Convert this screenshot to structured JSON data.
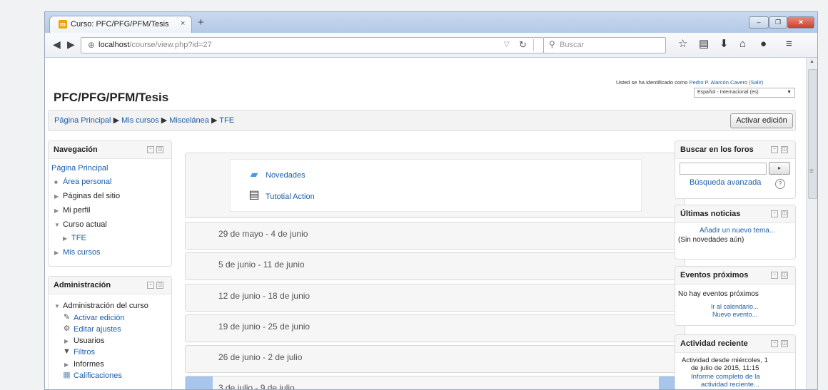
{
  "browser": {
    "tab_title": "Curso: PFC/PFG/PFM/Tesis",
    "tab_favicon": "moodle-icon",
    "tab_close": "×",
    "new_tab": "+",
    "url_host": "localhost",
    "url_path": "/course/view.php?id=27",
    "search_placeholder": "Buscar"
  },
  "page": {
    "site_title": "PFC/PFG/PFM/Tesis",
    "logged_in_text": "Usted se ha identificado como ",
    "user_name": "Pedro P. Alarcón Cavero",
    "logout_label": "(Salir)",
    "language": "Español - Internacional (es)"
  },
  "breadcrumb": {
    "home": "Página Principal",
    "my_courses": "Mis cursos",
    "category": "Miscelánea",
    "course": "TFE",
    "separator": "▶",
    "edit_button": "Activar edición"
  },
  "navigation": {
    "title": "Navegación",
    "home": "Página Principal",
    "dashboard": "Área personal",
    "site_pages": "Páginas del sitio",
    "profile": "Mi perfil",
    "current_course": "Curso actual",
    "course_short": "TFE",
    "my_courses": "Mis cursos"
  },
  "administration": {
    "title": "Administración",
    "course_admin": "Administración del curso",
    "toggle_edit": "Activar edición",
    "edit_settings": "Editar ajustes",
    "users": "Usuarios",
    "filters": "Filtros",
    "reports": "Informes",
    "grades": "Calificaciones"
  },
  "course": {
    "activities": [
      {
        "name": "Novedades",
        "icon": "forum-icon"
      },
      {
        "name": "Tutotial Action",
        "icon": "assignment-icon"
      }
    ],
    "weeks": [
      "29 de mayo - 4 de junio",
      "5 de junio - 11 de junio",
      "12 de junio - 18 de junio",
      "19 de junio - 25 de junio",
      "26 de junio - 2 de julio",
      "3 de julio - 9 de julio"
    ],
    "current_week_highlight": "#a8c6ec"
  },
  "forum_search": {
    "title": "Buscar en los foros",
    "go_button": "Ir",
    "advanced": "Búsqueda avanzada"
  },
  "latest_news": {
    "title": "Últimas noticias",
    "add_topic": "Añadir un nuevo tema...",
    "empty": "(Sin novedades aún)"
  },
  "upcoming_events": {
    "title": "Eventos próximos",
    "empty": "No hay eventos próximos",
    "go_calendar": "Ir al calendario...",
    "new_event": "Nuevo evento..."
  },
  "recent_activity": {
    "title": "Actividad reciente",
    "since_line1": "Actividad desde miércoles, 1",
    "since_line2": "de julio de 2015, 11:15",
    "full_report_line1": "Informe completo de la",
    "full_report_line2": "actividad reciente..."
  },
  "colors": {
    "link": "#1a5ea8",
    "titlebar": "#c9d9ef"
  }
}
